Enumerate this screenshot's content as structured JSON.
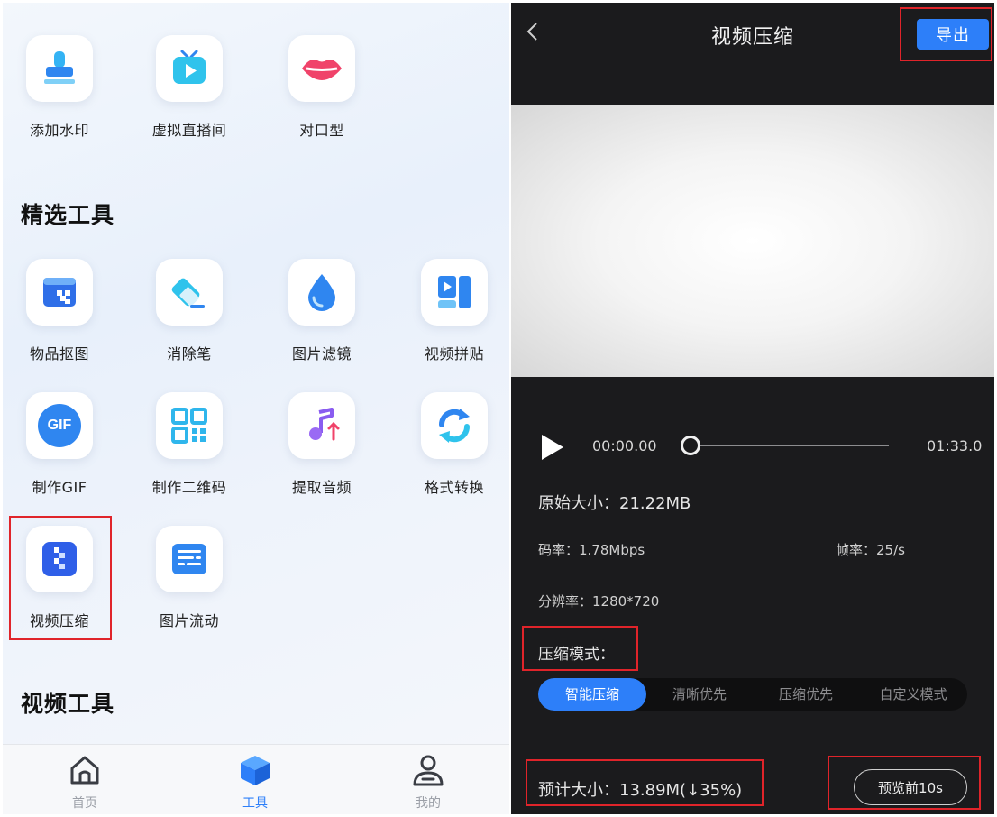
{
  "left": {
    "top_tools": [
      {
        "label": "添加水印",
        "icon": "stamp-icon"
      },
      {
        "label": "虚拟直播间",
        "icon": "tv-icon"
      },
      {
        "label": "对口型",
        "icon": "lips-icon"
      }
    ],
    "featured": {
      "title": "精选工具",
      "tools": [
        {
          "label": "物品抠图",
          "icon": "cutout-icon"
        },
        {
          "label": "消除笔",
          "icon": "eraser-icon"
        },
        {
          "label": "图片滤镜",
          "icon": "drop-icon"
        },
        {
          "label": "视频拼贴",
          "icon": "collage-icon"
        },
        {
          "label": "制作GIF",
          "icon": "gif-icon",
          "icon_text": "GIF"
        },
        {
          "label": "制作二维码",
          "icon": "qrcode-icon"
        },
        {
          "label": "提取音频",
          "icon": "music-icon"
        },
        {
          "label": "格式转换",
          "icon": "convert-icon"
        },
        {
          "label": "视频压缩",
          "icon": "compress-icon"
        },
        {
          "label": "图片流动",
          "icon": "image-flow-icon"
        }
      ]
    },
    "video_tools": {
      "title": "视频工具"
    },
    "nav": [
      {
        "label": "首页",
        "icon": "home-icon",
        "active": false
      },
      {
        "label": "工具",
        "icon": "cube-icon",
        "active": true
      },
      {
        "label": "我的",
        "icon": "user-icon",
        "active": false
      }
    ]
  },
  "right": {
    "title": "视频压缩",
    "export_label": "导出",
    "player": {
      "current_time": "00:00.00",
      "total_time": "01:33.0",
      "progress": 0
    },
    "info": {
      "original_size": "原始大小：21.22MB",
      "bitrate": "码率：1.78Mbps",
      "framerate": "帧率：25/s",
      "resolution": "分辨率：1280*720"
    },
    "compress_mode_label": "压缩模式：",
    "modes": [
      {
        "label": "智能压缩",
        "active": true
      },
      {
        "label": "清晰优先",
        "active": false
      },
      {
        "label": "压缩优先",
        "active": false
      },
      {
        "label": "自定义模式",
        "active": false
      }
    ],
    "estimated_size": "预计大小：13.89M(↓35%)",
    "preview_label": "预览前10s"
  },
  "colors": {
    "accent": "#2d7ff9",
    "highlight_box": "#e0242a",
    "dark_bg": "#1b1b1d"
  }
}
